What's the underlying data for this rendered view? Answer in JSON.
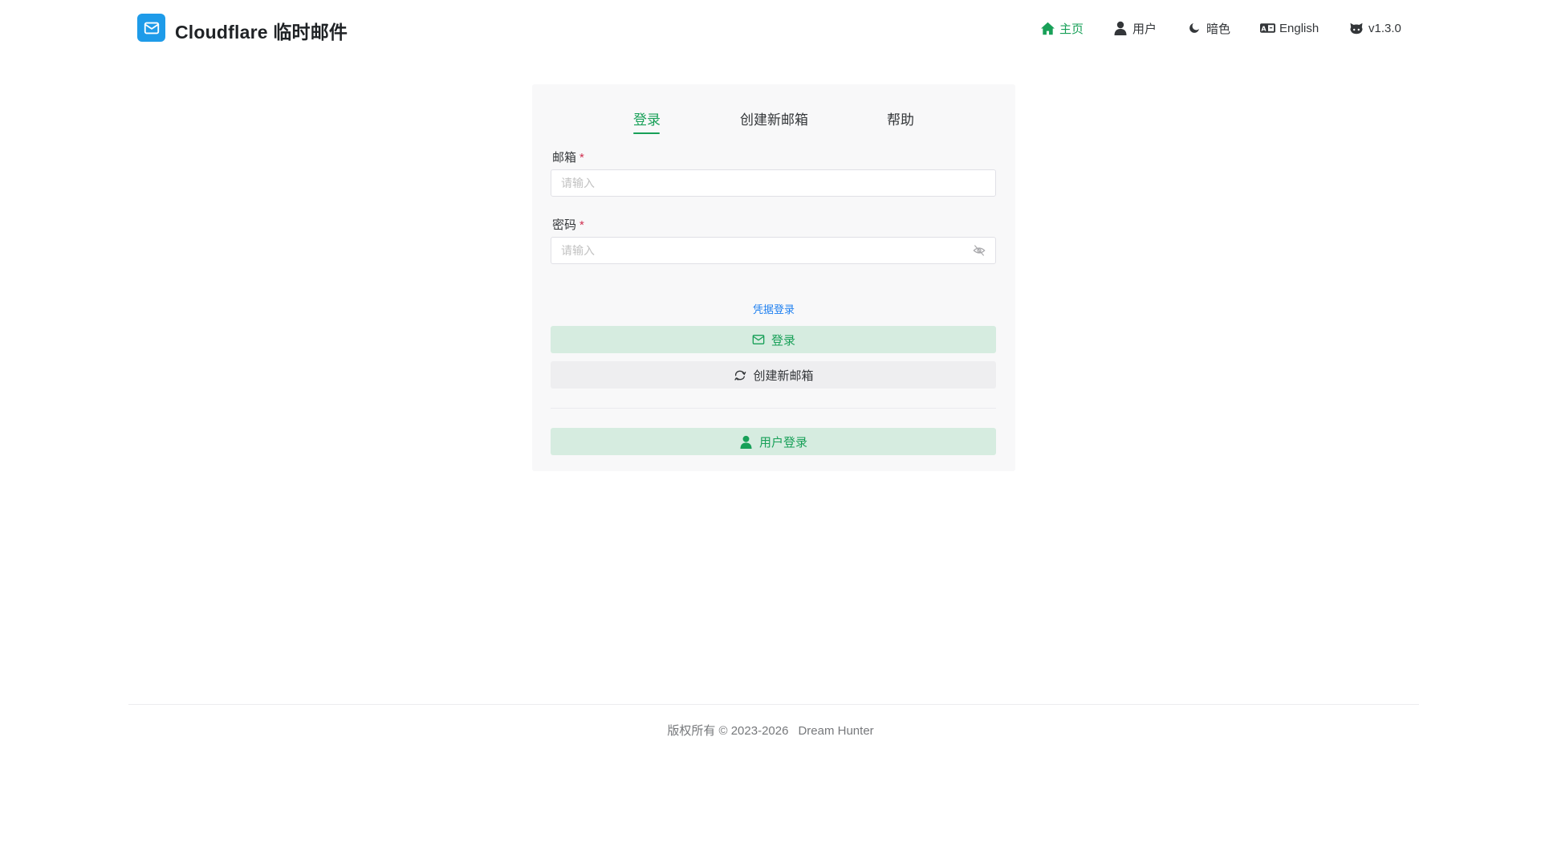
{
  "header": {
    "title": "Cloudflare 临时邮件",
    "logo_icon": "mail-icon",
    "nav": [
      {
        "label": "主页",
        "icon": "home-icon",
        "active": true
      },
      {
        "label": "用户",
        "icon": "user-icon"
      },
      {
        "label": "暗色",
        "icon": "moon-icon"
      },
      {
        "label": "English",
        "icon": "translate-icon"
      },
      {
        "label": "v1.3.0",
        "icon": "github-icon"
      }
    ]
  },
  "tabs": [
    {
      "label": "登录",
      "active": true
    },
    {
      "label": "创建新邮箱"
    },
    {
      "label": "帮助"
    }
  ],
  "form": {
    "email_label": "邮箱",
    "email_placeholder": "请输入",
    "email_value": "",
    "password_label": "密码",
    "password_placeholder": "请输入",
    "password_value": "",
    "required_mark": "*",
    "credential_link": "凭据登录"
  },
  "buttons": {
    "login": "登录",
    "create": "创建新邮箱",
    "user_login": "用户登录"
  },
  "footer": {
    "copyright": "版权所有 © 2023-2026",
    "author": "Dream Hunter"
  },
  "colors": {
    "accent": "#18a058",
    "link": "#2080f0",
    "logo": "#1e9be9",
    "required": "#d03050"
  }
}
